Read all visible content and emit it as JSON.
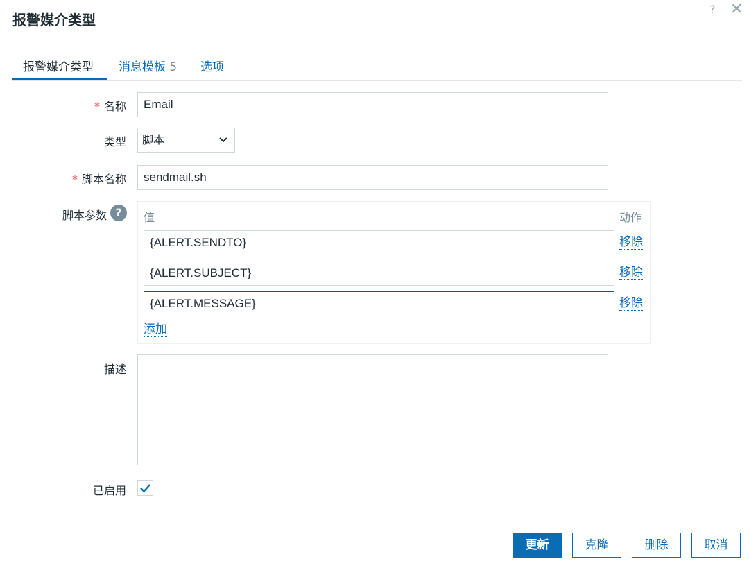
{
  "dialog": {
    "title": "报警媒介类型",
    "help_icon": "?",
    "close_icon": "✕"
  },
  "tabs": [
    {
      "label": "报警媒介类型",
      "active": true
    },
    {
      "label": "消息模板",
      "count": "5"
    },
    {
      "label": "选项"
    }
  ],
  "form": {
    "name": {
      "label": "名称",
      "required": true,
      "value": "Email"
    },
    "type": {
      "label": "类型",
      "value": "脚本"
    },
    "script_name": {
      "label": "脚本名称",
      "required": true,
      "value": "sendmail.sh"
    },
    "script_params": {
      "label": "脚本参数",
      "help": "?",
      "col_value": "值",
      "col_action": "动作",
      "rows": [
        {
          "value": "{ALERT.SENDTO}",
          "action": "移除"
        },
        {
          "value": "{ALERT.SUBJECT}",
          "action": "移除"
        },
        {
          "value": "{ALERT.MESSAGE}",
          "action": "移除"
        }
      ],
      "add_label": "添加"
    },
    "description": {
      "label": "描述",
      "value": ""
    },
    "enabled": {
      "label": "已启用",
      "checked": true
    }
  },
  "buttons": {
    "update": "更新",
    "clone": "克隆",
    "delete": "删除",
    "cancel": "取消"
  },
  "colors": {
    "accent": "#0a6cb5",
    "required": "#e45959"
  }
}
